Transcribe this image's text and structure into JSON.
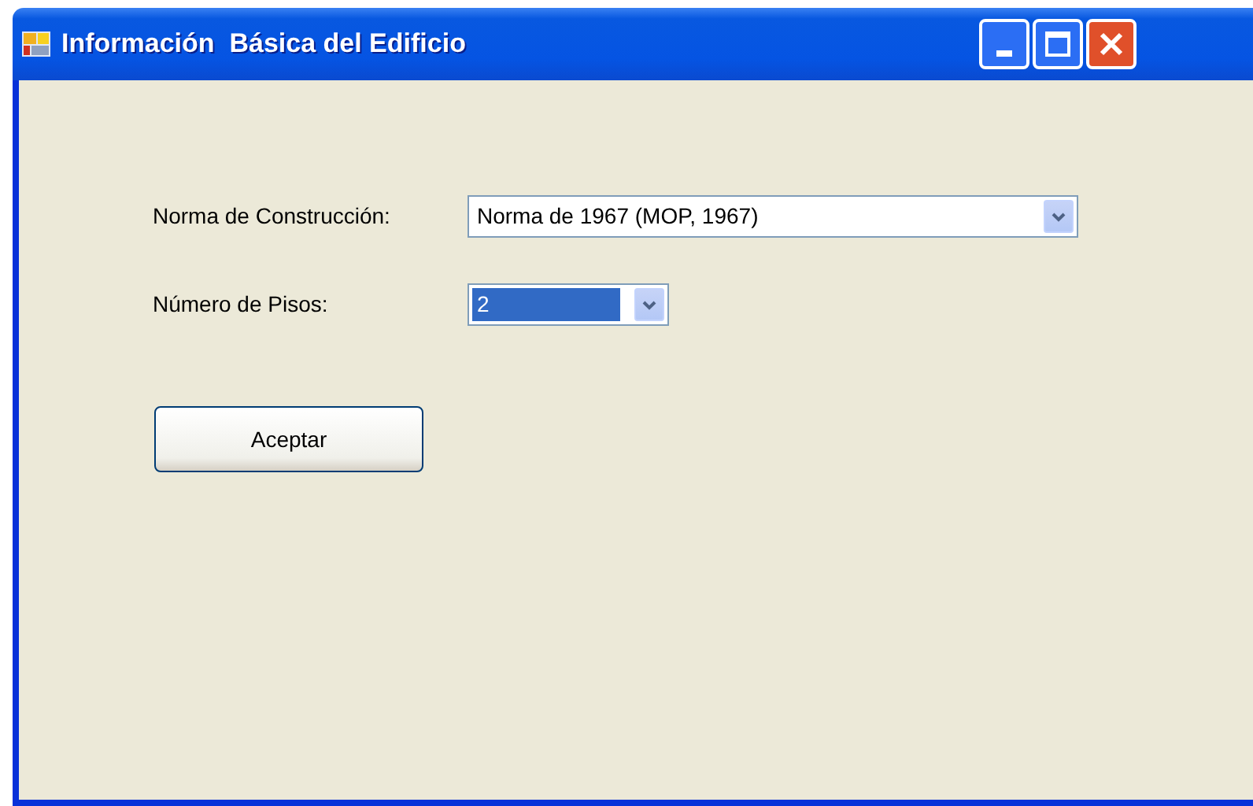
{
  "window": {
    "title": "Información  Básica del Edificio"
  },
  "fields": [
    {
      "label": "Norma de Construcción:",
      "value": "Norma de 1967 (MOP, 1967)",
      "focused": false,
      "kind": "wide"
    },
    {
      "label": "Número de Pisos:",
      "value": "2",
      "focused": true,
      "kind": "narrow"
    }
  ],
  "buttons": [
    "Aceptar"
  ]
}
